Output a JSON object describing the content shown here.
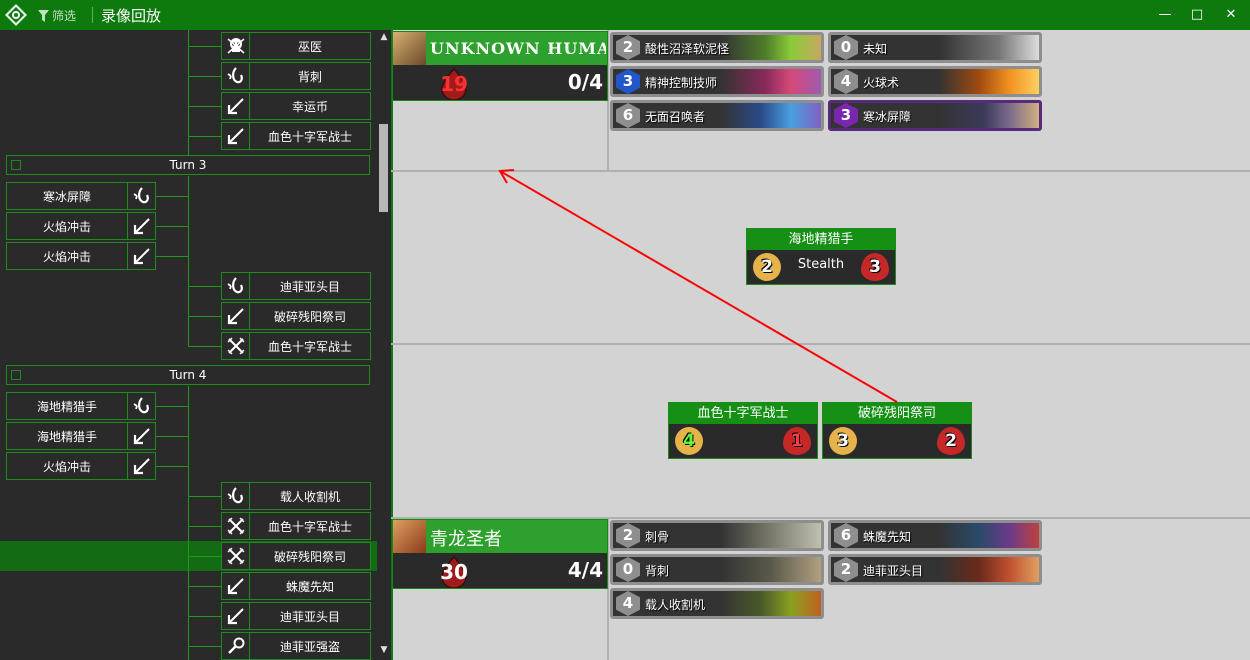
{
  "titlebar": {
    "filter_label": "筛选",
    "title": "录像回放",
    "minimize": "—",
    "maximize": "□",
    "close": "✕"
  },
  "timeline": {
    "turn3_label": "Turn 3",
    "turn4_label": "Turn 4",
    "actions_top": [
      {
        "label": "巫医",
        "icon": "skull-icon"
      },
      {
        "label": "背刺",
        "icon": "hook-icon"
      },
      {
        "label": "幸运币",
        "icon": "play-arrow-icon"
      },
      {
        "label": "血色十字军战士",
        "icon": "play-arrow-icon"
      }
    ],
    "turn3_player": [
      {
        "label": "寒冰屏障",
        "icon": "hook-icon"
      },
      {
        "label": "火焰冲击",
        "icon": "play-arrow-icon"
      },
      {
        "label": "火焰冲击",
        "icon": "play-arrow-icon"
      }
    ],
    "turn3_opponent": [
      {
        "label": "迪菲亚头目",
        "icon": "hook-icon"
      },
      {
        "label": "破碎残阳祭司",
        "icon": "play-arrow-icon"
      },
      {
        "label": "血色十字军战士",
        "icon": "crossed-swords-icon"
      }
    ],
    "turn4_player": [
      {
        "label": "海地精猎手",
        "icon": "hook-icon"
      },
      {
        "label": "海地精猎手",
        "icon": "play-arrow-icon"
      },
      {
        "label": "火焰冲击",
        "icon": "play-arrow-icon"
      }
    ],
    "turn4_opponent": [
      {
        "label": "载人收割机",
        "icon": "hook-icon"
      },
      {
        "label": "血色十字军战士",
        "icon": "crossed-swords-icon"
      },
      {
        "label": "破碎残阳祭司",
        "icon": "crossed-swords-icon"
      },
      {
        "label": "蛛魔先知",
        "icon": "play-arrow-icon"
      },
      {
        "label": "迪菲亚头目",
        "icon": "play-arrow-icon"
      },
      {
        "label": "迪菲亚强盗",
        "icon": "magnifier-icon"
      }
    ]
  },
  "opponent_hero": {
    "name": "UNKNOWN HUMAN",
    "health": "19",
    "mana": "0/4"
  },
  "player_hero": {
    "name": "青龙圣者",
    "health": "30",
    "mana": "4/4"
  },
  "opponent_cards": [
    {
      "cost": "2",
      "name": "酸性沼泽软泥怪",
      "gem": "grey"
    },
    {
      "cost": "0",
      "name": "未知",
      "gem": "grey"
    },
    {
      "cost": "3",
      "name": "精神控制技师",
      "gem": "blue"
    },
    {
      "cost": "4",
      "name": "火球术",
      "gem": "grey"
    },
    {
      "cost": "6",
      "name": "无面召唤者",
      "gem": "grey"
    },
    {
      "cost": "3",
      "name": "寒冰屏障",
      "gem": "purple"
    }
  ],
  "player_cards": [
    {
      "cost": "2",
      "name": "刺骨"
    },
    {
      "cost": "6",
      "name": "蛛魔先知"
    },
    {
      "cost": "0",
      "name": "背刺"
    },
    {
      "cost": "2",
      "name": "迪菲亚头目"
    },
    {
      "cost": "4",
      "name": "载人收割机"
    }
  ],
  "opponent_minions": [
    {
      "name": "海地精猎手",
      "attack": "2",
      "health": "3",
      "keyword": "Stealth"
    }
  ],
  "player_minions": [
    {
      "name": "血色十字军战士",
      "attack": "4",
      "health": "1"
    },
    {
      "name": "破碎残阳祭司",
      "attack": "3",
      "health": "2"
    }
  ],
  "colors": {
    "accent": "#0f7a10",
    "attack_arrow": "#ff0000"
  }
}
